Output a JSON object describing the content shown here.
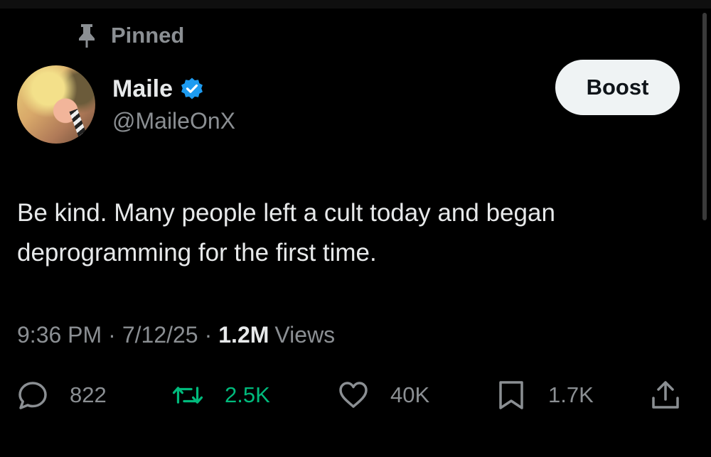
{
  "pinned": {
    "label": "Pinned",
    "icon": "pin-icon"
  },
  "author": {
    "display_name": "Maile",
    "handle": "@MaileOnX",
    "verified_color": "#1d9bf0"
  },
  "boost": {
    "label": "Boost"
  },
  "tweet": {
    "text": "Be kind. Many people left a cult today and began\ndeprogramming for the first time."
  },
  "meta": {
    "time": "9:36 PM",
    "separator": "·",
    "date": "7/12/25",
    "views_count": "1.2M",
    "views_label": "Views"
  },
  "actions": {
    "reply": {
      "count": "822",
      "icon": "reply-icon"
    },
    "retweet": {
      "count": "2.5K",
      "icon": "retweet-icon",
      "color": "#00ba7c"
    },
    "like": {
      "count": "40K",
      "icon": "heart-icon"
    },
    "bookmark": {
      "count": "1.7K",
      "icon": "bookmark-icon"
    },
    "share": {
      "icon": "share-icon"
    }
  }
}
